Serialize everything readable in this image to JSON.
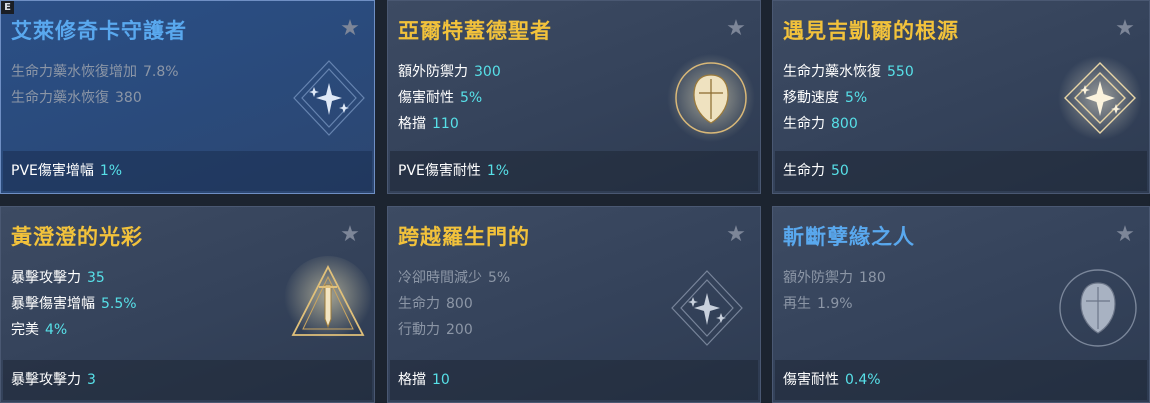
{
  "hotkey": {
    "label": "E"
  },
  "cards": [
    {
      "title": "艾萊修奇卡守護者",
      "stats": [
        {
          "label": "生命力藥水恢復增加",
          "value": "7.8%"
        },
        {
          "label": "生命力藥水恢復",
          "value": "380"
        }
      ],
      "footer": {
        "label": "PVE傷害增幅",
        "value": "1%"
      },
      "emblem": "sparkle-diamond-icon"
    },
    {
      "title": "亞爾特蓋德聖者",
      "stats": [
        {
          "label": "額外防禦力",
          "value": "300"
        },
        {
          "label": "傷害耐性",
          "value": "5%"
        },
        {
          "label": "格擋",
          "value": "110"
        }
      ],
      "footer": {
        "label": "PVE傷害耐性",
        "value": "1%"
      },
      "emblem": "shield-circle-icon"
    },
    {
      "title": "遇見吉凱爾的根源",
      "stats": [
        {
          "label": "生命力藥水恢復",
          "value": "550"
        },
        {
          "label": "移動速度",
          "value": "5%"
        },
        {
          "label": "生命力",
          "value": "800"
        }
      ],
      "footer": {
        "label": "生命力",
        "value": "50"
      },
      "emblem": "sparkle-diamond-icon"
    },
    {
      "title": "黃澄澄的光彩",
      "stats": [
        {
          "label": "暴擊攻擊力",
          "value": "35"
        },
        {
          "label": "暴擊傷害增幅",
          "value": "5.5%"
        },
        {
          "label": "完美",
          "value": "4%"
        }
      ],
      "footer": {
        "label": "暴擊攻擊力",
        "value": "3"
      },
      "emblem": "sword-triangle-icon"
    },
    {
      "title": "跨越羅生門的",
      "stats": [
        {
          "label": "冷卻時間減少",
          "value": "5%"
        },
        {
          "label": "生命力",
          "value": "800"
        },
        {
          "label": "行動力",
          "value": "200"
        }
      ],
      "footer": {
        "label": "格擋",
        "value": "10"
      },
      "emblem": "sparkle-diamond-icon"
    },
    {
      "title": "斬斷孽緣之人",
      "stats": [
        {
          "label": "額外防禦力",
          "value": "180"
        },
        {
          "label": "再生",
          "value": "1.9%"
        }
      ],
      "footer": {
        "label": "傷害耐性",
        "value": "0.4%"
      },
      "emblem": "shield-circle-icon"
    }
  ],
  "colors": {
    "title_gold": "#f2c23b",
    "title_blue": "#59a8ee",
    "value_cyan": "#57e0e8",
    "dim_text": "#8c96a6"
  }
}
